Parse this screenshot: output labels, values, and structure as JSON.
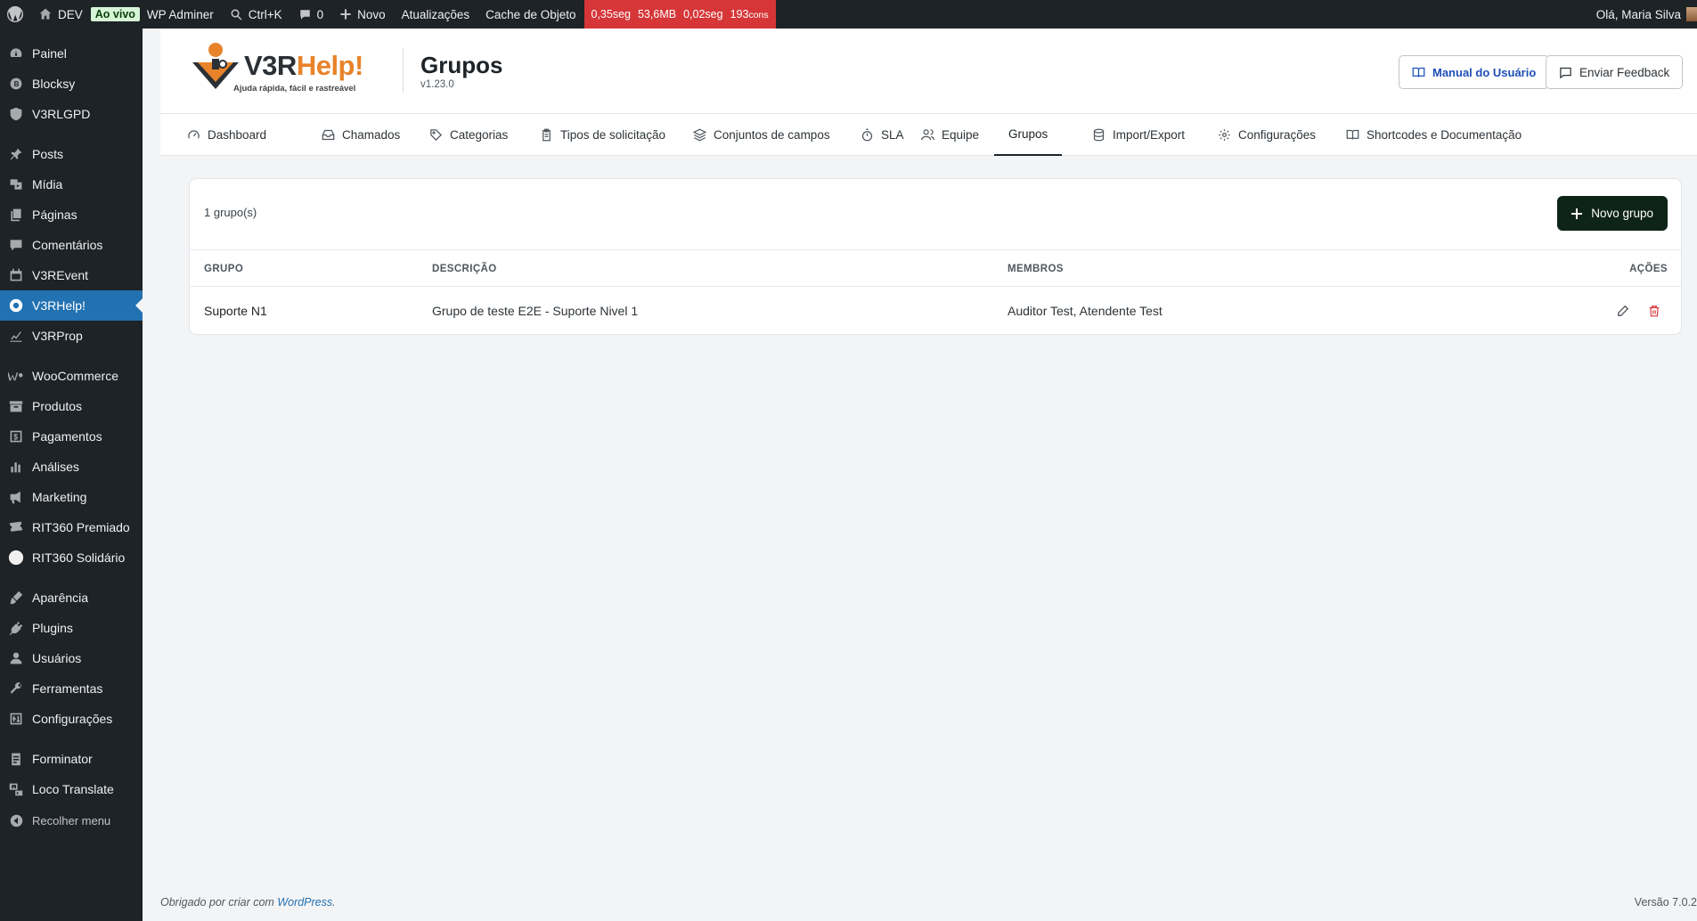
{
  "adminbar": {
    "site": "DEV",
    "live_badge": "Ao vivo",
    "adminer": "WP Adminer",
    "search": "Ctrl+K",
    "comments_count": "0",
    "new": "Novo",
    "updates": "Atualizações",
    "cache": "Cache de Objeto",
    "perf_time": "0,35seg",
    "perf_mem": "53,6MB",
    "perf_db": "0,02seg",
    "perf_queries": "193",
    "perf_queries_unit": "cons",
    "greeting": "Olá, Maria Silva"
  },
  "sidebar": {
    "items": [
      {
        "label": "Painel",
        "icon": "dashboard-icon"
      },
      {
        "label": "Blocksy",
        "icon": "blocksy-icon"
      },
      {
        "label": "V3RLGPD",
        "icon": "shield-icon"
      },
      {
        "label": "Posts",
        "icon": "pin-icon"
      },
      {
        "label": "Mídia",
        "icon": "media-icon"
      },
      {
        "label": "Páginas",
        "icon": "pages-icon"
      },
      {
        "label": "Comentários",
        "icon": "comment-icon"
      },
      {
        "label": "V3REvent",
        "icon": "calendar-icon"
      },
      {
        "label": "V3RHelp!",
        "icon": "lifebuoy-icon"
      },
      {
        "label": "V3RProp",
        "icon": "chart-icon"
      },
      {
        "label": "WooCommerce",
        "icon": "woo-icon"
      },
      {
        "label": "Produtos",
        "icon": "archive-icon"
      },
      {
        "label": "Pagamentos",
        "icon": "dollar-icon"
      },
      {
        "label": "Análises",
        "icon": "bar-chart-icon"
      },
      {
        "label": "Marketing",
        "icon": "megaphone-icon"
      },
      {
        "label": "RIT360 Premiado",
        "icon": "ticket-icon"
      },
      {
        "label": "RIT360 Solidário",
        "icon": "circle-icon"
      },
      {
        "label": "Aparência",
        "icon": "brush-icon"
      },
      {
        "label": "Plugins",
        "icon": "plugin-icon"
      },
      {
        "label": "Usuários",
        "icon": "user-icon"
      },
      {
        "label": "Ferramentas",
        "icon": "wrench-icon"
      },
      {
        "label": "Configurações",
        "icon": "settings-icon"
      },
      {
        "label": "Forminator",
        "icon": "form-icon"
      },
      {
        "label": "Loco Translate",
        "icon": "translate-icon"
      },
      {
        "label": "Recolher menu",
        "icon": "collapse-icon"
      }
    ],
    "active_label": "V3RHelp!"
  },
  "header": {
    "logo_v3r": "V3R",
    "logo_help": "Help!",
    "logo_tagline": "Ajuda rápida, fácil e rastreável",
    "title": "Grupos",
    "version": "v1.23.0",
    "manual_button": "Manual do Usuário",
    "feedback_button": "Enviar Feedback"
  },
  "tabs": [
    {
      "label": "Dashboard",
      "icon": "gauge-icon"
    },
    {
      "label": "Chamados",
      "icon": "inbox-icon"
    },
    {
      "label": "Categorias",
      "icon": "tag-icon"
    },
    {
      "label": "Tipos de solicitação",
      "icon": "clipboard-icon"
    },
    {
      "label": "Conjuntos de campos",
      "icon": "layers-icon"
    },
    {
      "label": "SLA",
      "icon": "timer-icon"
    },
    {
      "label": "Equipe",
      "icon": "users-icon"
    },
    {
      "label": "Grupos",
      "icon": ""
    },
    {
      "label": "Import/Export",
      "icon": "database-icon"
    },
    {
      "label": "Configurações",
      "icon": "gear-icon"
    },
    {
      "label": "Shortcodes e Documentação",
      "icon": "book-icon"
    }
  ],
  "active_tab": "Grupos",
  "groups": {
    "count_text": "1 grupo(s)",
    "new_button": "Novo grupo",
    "columns": {
      "group": "GRUPO",
      "description": "DESCRIÇÃO",
      "members": "MEMBROS",
      "actions": "AÇÕES"
    },
    "rows": [
      {
        "name": "Suporte N1",
        "description": "Grupo de teste E2E - Suporte Nivel 1",
        "members": "Auditor Test, Atendente Test"
      }
    ]
  },
  "colors": {
    "accent": "#2271b1",
    "primary_button": "#0f2419",
    "delete": "#d63638",
    "brand_orange": "#e8832a"
  },
  "footer": {
    "thanks_prefix": "Obrigado por criar com ",
    "thanks_link": "WordPress",
    "thanks_suffix": ".",
    "version": "Versão 7.0.2"
  }
}
